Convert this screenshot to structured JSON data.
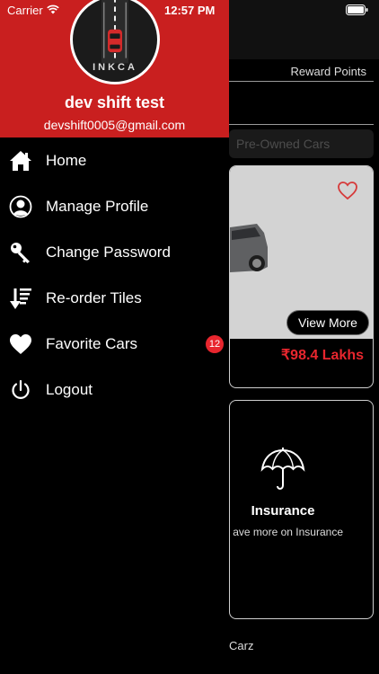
{
  "status_bar": {
    "carrier": "Carrier",
    "time": "12:57 PM"
  },
  "drawer": {
    "avatar_logo_text": "INKCA",
    "user_name": "dev shift test",
    "user_email": "devshift0005@gmail.com",
    "menu": [
      {
        "label": "Home",
        "icon": "home-icon"
      },
      {
        "label": "Manage Profile",
        "icon": "profile-icon"
      },
      {
        "label": "Change Password",
        "icon": "key-icon"
      },
      {
        "label": "Re-order Tiles",
        "icon": "reorder-icon"
      },
      {
        "label": "Favorite Cars",
        "icon": "heart-icon",
        "badge": "12"
      },
      {
        "label": "Logout",
        "icon": "power-icon"
      }
    ]
  },
  "background": {
    "reward_points": "Reward Points",
    "tab_preowned": "Pre-Owned Cars",
    "view_more": "View More",
    "price": "₹98.4 Lakhs",
    "insurance_title": "Insurance",
    "insurance_subtitle": "ave more on Insurance",
    "carz_label": "Carz"
  },
  "colors": {
    "accent": "#c91f1f",
    "price": "#e8262e",
    "badge": "#e8262e"
  }
}
